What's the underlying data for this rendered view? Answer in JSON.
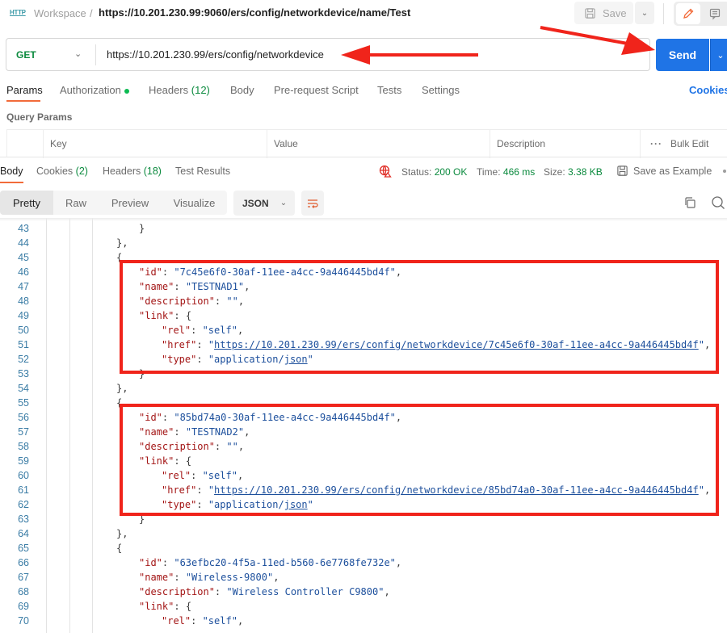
{
  "header": {
    "icon": "http-request-icon",
    "breadcrumb_workspace": "Workspace",
    "breadcrumb_separator": "/",
    "request_title": "https://10.201.230.99:9060/ers/config/networkdevice/name/Test",
    "save_label": "Save"
  },
  "request": {
    "method": "GET",
    "url": "https://10.201.230.99/ers/config/networkdevice",
    "send_label": "Send",
    "tabs": [
      {
        "label": "Params",
        "count": "",
        "active": true
      },
      {
        "label": "Authorization",
        "count": "",
        "dot": true
      },
      {
        "label": "Headers",
        "count": "(12)"
      },
      {
        "label": "Body",
        "count": ""
      },
      {
        "label": "Pre-request Script",
        "count": ""
      },
      {
        "label": "Tests",
        "count": ""
      },
      {
        "label": "Settings",
        "count": ""
      }
    ],
    "cookies_label": "Cookies",
    "query_params": {
      "title": "Query Params",
      "columns": [
        "Key",
        "Value",
        "Description"
      ],
      "bulk_edit_label": "Bulk Edit"
    }
  },
  "response": {
    "tabs": [
      {
        "label": "Body",
        "count": "",
        "active": true
      },
      {
        "label": "Cookies",
        "count": "(2)"
      },
      {
        "label": "Headers",
        "count": "(18)"
      },
      {
        "label": "Test Results",
        "count": ""
      }
    ],
    "status_label": "Status:",
    "status_value": "200 OK",
    "time_label": "Time:",
    "time_value": "466 ms",
    "size_label": "Size:",
    "size_value": "3.38 KB",
    "save_example_label": "Save as Example",
    "view_modes": [
      "Pretty",
      "Raw",
      "Preview",
      "Visualize"
    ],
    "active_view": "Pretty",
    "format": "JSON"
  },
  "code_lines": [
    {
      "n": "43",
      "text": "}"
    },
    {
      "n": "44",
      "text": "},"
    },
    {
      "n": "45",
      "text": "{"
    },
    {
      "n": "46",
      "key": "id",
      "val": "7c45e6f0-30af-11ee-a4cc-9a446445bd4f"
    },
    {
      "n": "47",
      "key": "name",
      "val": "TESTNAD1"
    },
    {
      "n": "48",
      "key": "description",
      "val": ""
    },
    {
      "n": "49",
      "key": "link",
      "open": "{"
    },
    {
      "n": "50",
      "key": "rel",
      "val": "self"
    },
    {
      "n": "51",
      "key": "href",
      "val": "https://10.201.230.99/ers/config/networkdevice/7c45e6f0-30af-11ee-a4cc-9a446445bd4f"
    },
    {
      "n": "52",
      "key": "type",
      "val": "application/json"
    },
    {
      "n": "53",
      "text": "}"
    },
    {
      "n": "54",
      "text": "},"
    },
    {
      "n": "55",
      "text": "{"
    },
    {
      "n": "56",
      "key": "id",
      "val": "85bd74a0-30af-11ee-a4cc-9a446445bd4f"
    },
    {
      "n": "57",
      "key": "name",
      "val": "TESTNAD2"
    },
    {
      "n": "58",
      "key": "description",
      "val": ""
    },
    {
      "n": "59",
      "key": "link",
      "open": "{"
    },
    {
      "n": "60",
      "key": "rel",
      "val": "self"
    },
    {
      "n": "61",
      "key": "href",
      "val": "https://10.201.230.99/ers/config/networkdevice/85bd74a0-30af-11ee-a4cc-9a446445bd4f"
    },
    {
      "n": "62",
      "key": "type",
      "val": "application/json"
    },
    {
      "n": "63",
      "text": "}"
    },
    {
      "n": "64",
      "text": "},"
    },
    {
      "n": "65",
      "text": "{"
    },
    {
      "n": "66",
      "key": "id",
      "val": "63efbc20-4f5a-11ed-b560-6e7768fe732e"
    },
    {
      "n": "67",
      "key": "name",
      "val": "Wireless-9800"
    },
    {
      "n": "68",
      "key": "description",
      "val": "Wireless Controller C9800"
    },
    {
      "n": "69",
      "key": "link",
      "open": "{"
    },
    {
      "n": "70",
      "key": "rel",
      "val": "self"
    }
  ],
  "colors": {
    "accent_orange": "#f26b3a",
    "send_blue": "#1f74e6",
    "status_green": "#0b8a3e",
    "annotation_red": "#f0241b"
  }
}
